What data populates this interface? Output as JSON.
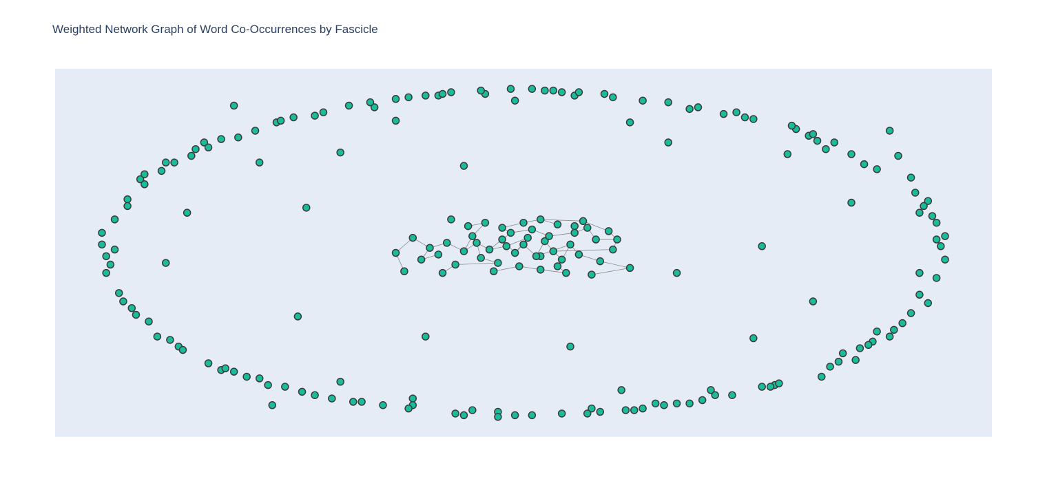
{
  "title": "Weighted Network Graph of Word Co-Occurrences by Fascicle",
  "colors": {
    "plot_bg": "#e5ecf6",
    "node_fill": "#1abc9c",
    "node_stroke": "#3a3a3a",
    "edge": "#888888"
  },
  "chart_data": {
    "type": "scatter",
    "title": "Weighted Network Graph of Word Co-Occurrences by Fascicle",
    "xlabel": "",
    "ylabel": "",
    "xlim": [
      -1.1,
      1.1
    ],
    "ylim": [
      -1.1,
      1.1
    ],
    "grid": false,
    "showlegend": false,
    "axes_visible": false,
    "ring_nodes": [
      [
        -0.9,
        0.44
      ],
      [
        -0.79,
        0.24
      ],
      [
        -0.68,
        0.88
      ],
      [
        -0.62,
        0.54
      ],
      [
        -0.59,
        -0.91
      ],
      [
        -0.53,
        -0.38
      ],
      [
        -0.51,
        0.27
      ],
      [
        -0.43,
        0.6
      ],
      [
        -0.26,
        -0.87
      ],
      [
        -0.23,
        -0.5
      ],
      [
        -0.17,
        0.2
      ],
      [
        -0.14,
        0.52
      ],
      [
        0.04,
        -0.02
      ],
      [
        0.11,
        -0.56
      ],
      [
        0.12,
        0.16
      ],
      [
        0.23,
        -0.82
      ],
      [
        0.34,
        0.66
      ],
      [
        0.36,
        -0.12
      ],
      [
        0.54,
        -0.51
      ],
      [
        0.56,
        0.04
      ],
      [
        0.62,
        0.59
      ],
      [
        0.68,
        -0.29
      ],
      [
        0.77,
        0.3
      ],
      [
        0.86,
        0.73
      ],
      [
        0.93,
        -0.12
      ],
      [
        0.7,
        -0.74
      ],
      [
        0.44,
        -0.82
      ],
      [
        0.25,
        0.78
      ],
      [
        -0.02,
        0.91
      ],
      [
        -0.3,
        0.79
      ],
      [
        -0.84,
        -0.06
      ],
      [
        -0.74,
        -0.66
      ],
      [
        0.97,
        0.08
      ],
      [
        -0.96,
        0.02
      ],
      [
        -0.06,
        -0.95
      ],
      [
        0.82,
        -0.53
      ],
      [
        0.05,
        0.97
      ],
      [
        -0.67,
        0.69
      ],
      [
        0.52,
        0.81
      ],
      [
        -0.43,
        -0.77
      ],
      [
        0.91,
        0.45
      ],
      [
        -0.2,
        0.94
      ],
      [
        0.31,
        -0.9
      ],
      [
        -0.88,
        -0.41
      ],
      [
        0.67,
        0.7
      ],
      [
        -0.56,
        -0.8
      ],
      [
        0.16,
        -0.93
      ],
      [
        0.78,
        -0.64
      ],
      [
        -0.77,
        0.62
      ],
      [
        0.39,
        0.86
      ],
      [
        -0.12,
        -0.94
      ],
      [
        0.95,
        -0.3
      ],
      [
        -0.93,
        0.32
      ],
      [
        0.12,
        0.94
      ],
      [
        -0.35,
        0.87
      ],
      [
        0.59,
        -0.79
      ],
      [
        -0.81,
        -0.56
      ],
      [
        0.88,
        0.58
      ],
      [
        -0.26,
        -0.91
      ],
      [
        0.71,
        0.62
      ],
      [
        -0.98,
        -0.12
      ],
      [
        0.45,
        -0.85
      ],
      [
        -0.49,
        0.82
      ],
      [
        0.93,
        0.24
      ],
      [
        -0.71,
        -0.7
      ],
      [
        0.21,
        0.93
      ],
      [
        0.02,
        -0.97
      ],
      [
        -0.89,
        0.47
      ],
      [
        0.83,
        -0.47
      ],
      [
        -0.58,
        0.78
      ],
      [
        0.33,
        -0.91
      ],
      [
        -0.17,
        0.96
      ],
      [
        0.99,
        -0.04
      ],
      [
        -0.84,
        0.54
      ],
      [
        0.64,
        0.74
      ],
      [
        -0.38,
        -0.89
      ],
      [
        0.75,
        -0.6
      ],
      [
        -0.62,
        -0.75
      ],
      [
        0.47,
        0.83
      ],
      [
        -0.09,
        0.95
      ],
      [
        0.91,
        -0.36
      ],
      [
        -0.95,
        -0.24
      ],
      [
        0.09,
        -0.96
      ],
      [
        0.8,
        0.53
      ],
      [
        -0.75,
        0.66
      ],
      [
        0.56,
        -0.8
      ],
      [
        -0.47,
        0.84
      ],
      [
        0.28,
        0.91
      ],
      [
        -0.91,
        -0.37
      ],
      [
        0.97,
        0.18
      ],
      [
        -0.27,
        -0.93
      ],
      [
        0.69,
        0.67
      ],
      [
        -0.68,
        -0.71
      ],
      [
        0.18,
        -0.95
      ],
      [
        -0.99,
        0.12
      ],
      [
        0.87,
        -0.46
      ],
      [
        -0.54,
        0.81
      ],
      [
        0.41,
        0.87
      ],
      [
        -0.14,
        -0.97
      ],
      [
        0.95,
        0.31
      ],
      [
        -0.82,
        0.54
      ],
      [
        0.6,
        -0.78
      ],
      [
        -0.36,
        0.9
      ],
      [
        0.13,
        0.96
      ],
      [
        -0.86,
        -0.5
      ],
      [
        0.77,
        0.59
      ],
      [
        -0.6,
        -0.79
      ],
      [
        0.36,
        -0.9
      ],
      [
        -0.03,
        0.98
      ],
      [
        0.93,
        -0.25
      ],
      [
        -0.93,
        0.28
      ],
      [
        0.5,
        0.84
      ],
      [
        -0.45,
        -0.87
      ],
      [
        0.72,
        -0.68
      ],
      [
        -0.71,
        0.68
      ],
      [
        0.24,
        -0.94
      ],
      [
        -0.19,
        0.95
      ],
      [
        0.98,
        0.04
      ],
      [
        -0.97,
        -0.07
      ],
      [
        0.83,
        0.5
      ],
      [
        -0.8,
        -0.58
      ],
      [
        0.42,
        -0.88
      ],
      [
        -0.41,
        0.88
      ],
      [
        0.07,
        0.97
      ],
      [
        -0.06,
        -0.98
      ],
      [
        0.89,
        -0.42
      ],
      [
        -0.89,
        0.41
      ],
      [
        0.63,
        0.76
      ],
      [
        -0.65,
        -0.74
      ],
      [
        0.28,
        -0.93
      ],
      [
        -0.3,
        0.92
      ],
      [
        0.96,
        0.22
      ],
      [
        -0.96,
        0.2
      ],
      [
        0.74,
        -0.65
      ],
      [
        -0.74,
        0.63
      ],
      [
        0.54,
        0.8
      ],
      [
        -0.52,
        -0.83
      ],
      [
        0.15,
        -0.96
      ],
      [
        -0.1,
        0.97
      ],
      [
        0.92,
        0.36
      ],
      [
        -0.92,
        -0.33
      ],
      [
        0.79,
        -0.57
      ],
      [
        -0.78,
        0.58
      ],
      [
        0.34,
        0.9
      ],
      [
        -0.33,
        -0.91
      ],
      [
        0.02,
        0.98
      ],
      [
        -0.02,
        -0.97
      ],
      [
        0.97,
        -0.15
      ],
      [
        -0.98,
        -0.02
      ],
      [
        0.68,
        0.71
      ],
      [
        -0.63,
        0.73
      ],
      [
        0.49,
        -0.85
      ],
      [
        -0.49,
        -0.85
      ],
      [
        0.19,
        0.95
      ],
      [
        -0.23,
        0.94
      ],
      [
        0.86,
        -0.5
      ],
      [
        -0.85,
        0.49
      ],
      [
        0.58,
        -0.8
      ],
      [
        -0.57,
        0.79
      ],
      [
        0.39,
        -0.9
      ],
      [
        -0.4,
        -0.89
      ],
      [
        0.09,
        0.96
      ],
      [
        -0.16,
        -0.96
      ],
      [
        0.94,
        0.28
      ],
      [
        -0.94,
        -0.29
      ],
      [
        0.73,
        0.66
      ],
      [
        -0.7,
        -0.69
      ],
      [
        0.26,
        -0.94
      ],
      [
        -0.27,
        0.93
      ],
      [
        0.99,
        0.1
      ],
      [
        -0.99,
        0.05
      ],
      [
        0.81,
        -0.55
      ],
      [
        -0.83,
        -0.52
      ]
    ],
    "center_nodes": [
      [
        -0.11,
        0.06
      ],
      [
        -0.08,
        0.02
      ],
      [
        -0.05,
        0.08
      ],
      [
        -0.02,
        0.0
      ],
      [
        0.0,
        0.05
      ],
      [
        0.03,
        -0.02
      ],
      [
        0.05,
        0.07
      ],
      [
        0.07,
        0.01
      ],
      [
        0.09,
        -0.04
      ],
      [
        0.11,
        0.05
      ],
      [
        -0.1,
        -0.03
      ],
      [
        -0.06,
        -0.06
      ],
      [
        -0.03,
        0.12
      ],
      [
        0.02,
        0.14
      ],
      [
        0.06,
        0.1
      ],
      [
        0.08,
        -0.08
      ],
      [
        -0.14,
        0.01
      ],
      [
        -0.12,
        0.1
      ],
      [
        0.12,
        0.12
      ],
      [
        0.13,
        -0.01
      ],
      [
        -0.18,
        0.06
      ],
      [
        -0.22,
        0.03
      ],
      [
        -0.24,
        -0.04
      ],
      [
        0.15,
        0.15
      ],
      [
        0.17,
        0.08
      ],
      [
        0.18,
        -0.05
      ],
      [
        -0.16,
        -0.07
      ],
      [
        -0.19,
        -0.12
      ],
      [
        0.1,
        -0.12
      ],
      [
        0.04,
        -0.1
      ],
      [
        -0.01,
        -0.08
      ],
      [
        -0.05,
        0.15
      ],
      [
        0.0,
        0.18
      ],
      [
        0.04,
        0.2
      ],
      [
        0.14,
        0.19
      ],
      [
        0.2,
        0.13
      ],
      [
        0.22,
        0.08
      ],
      [
        -0.26,
        0.09
      ],
      [
        -0.3,
        0.0
      ],
      [
        -0.28,
        -0.11
      ],
      [
        0.25,
        -0.09
      ],
      [
        0.16,
        -0.13
      ],
      [
        -0.09,
        0.18
      ],
      [
        -0.13,
        0.16
      ],
      [
        0.08,
        0.17
      ],
      [
        0.21,
        0.02
      ],
      [
        -0.2,
        -0.01
      ],
      [
        -0.07,
        -0.11
      ],
      [
        0.01,
        0.09
      ],
      [
        -0.04,
        0.04
      ]
    ],
    "edges": [
      [
        0,
        1
      ],
      [
        1,
        2
      ],
      [
        2,
        3
      ],
      [
        3,
        4
      ],
      [
        4,
        5
      ],
      [
        5,
        6
      ],
      [
        6,
        7
      ],
      [
        7,
        8
      ],
      [
        8,
        9
      ],
      [
        0,
        10
      ],
      [
        10,
        11
      ],
      [
        2,
        12
      ],
      [
        12,
        13
      ],
      [
        13,
        14
      ],
      [
        8,
        15
      ],
      [
        0,
        16
      ],
      [
        16,
        17
      ],
      [
        14,
        18
      ],
      [
        9,
        19
      ],
      [
        16,
        20
      ],
      [
        20,
        21
      ],
      [
        21,
        22
      ],
      [
        18,
        23
      ],
      [
        23,
        24
      ],
      [
        19,
        25
      ],
      [
        11,
        26
      ],
      [
        26,
        27
      ],
      [
        15,
        28
      ],
      [
        28,
        29
      ],
      [
        29,
        30
      ],
      [
        12,
        31
      ],
      [
        31,
        32
      ],
      [
        32,
        33
      ],
      [
        33,
        34
      ],
      [
        34,
        35
      ],
      [
        35,
        36
      ],
      [
        21,
        37
      ],
      [
        37,
        38
      ],
      [
        38,
        39
      ],
      [
        25,
        40
      ],
      [
        40,
        41
      ],
      [
        17,
        42
      ],
      [
        42,
        43
      ],
      [
        33,
        44
      ],
      [
        36,
        45
      ],
      [
        22,
        46
      ],
      [
        30,
        47
      ],
      [
        3,
        48
      ],
      [
        48,
        49
      ],
      [
        1,
        49
      ],
      [
        5,
        9
      ],
      [
        6,
        14
      ],
      [
        24,
        36
      ],
      [
        7,
        45
      ]
    ]
  }
}
